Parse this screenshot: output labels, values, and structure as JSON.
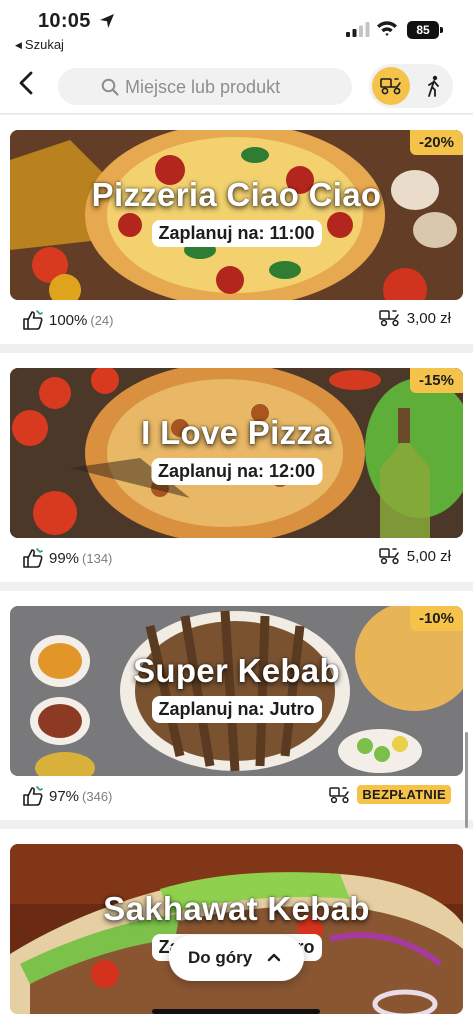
{
  "status_bar": {
    "time": "10:05",
    "back_app_label": "Szukaj",
    "battery": "85"
  },
  "top_nav": {
    "search_placeholder": "Miejsce lub produkt",
    "delivery_mode_icon": "delivery-scooter-icon",
    "pickup_mode_icon": "walking-person-icon",
    "selected_mode": "delivery"
  },
  "colors": {
    "accent": "#f5c24a",
    "background": "#f0f0f0",
    "card": "#ffffff"
  },
  "restaurants": [
    {
      "name": "Pizzeria Ciao Ciao",
      "schedule": "Zaplanuj na: 11:00",
      "discount": "-20%",
      "rating": "100%",
      "rating_count": "(24)",
      "delivery_fee": "3,00 zł"
    },
    {
      "name": "I Love Pizza",
      "schedule": "Zaplanuj na: 12:00",
      "discount": "-15%",
      "rating": "99%",
      "rating_count": "(134)",
      "delivery_fee": "5,00 zł"
    },
    {
      "name": "Super Kebab",
      "schedule": "Zaplanuj na: Jutro",
      "discount": "-10%",
      "rating": "97%",
      "rating_count": "(346)",
      "delivery_fee": "BEZPŁATNIE"
    },
    {
      "name": "Sakhawat Kebab",
      "schedule": "Zaplanuj na: Jutro",
      "discount": "",
      "rating": "",
      "rating_count": "",
      "delivery_fee": ""
    }
  ],
  "scroll_to_top": {
    "label": "Do góry"
  }
}
